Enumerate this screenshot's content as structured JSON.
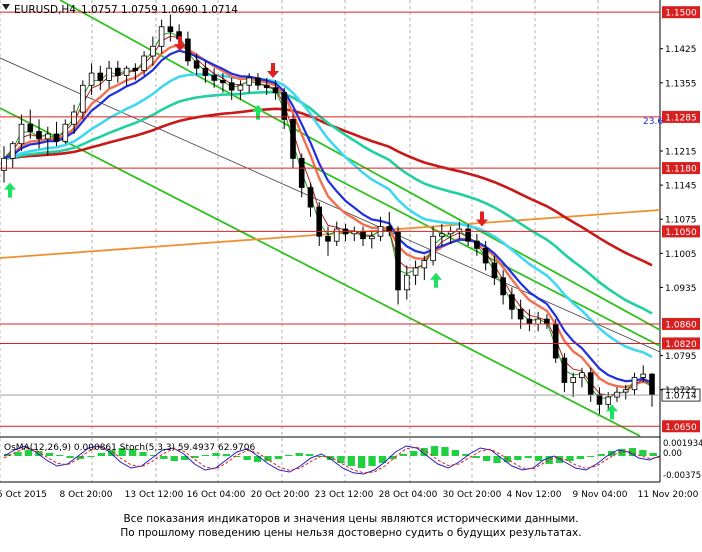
{
  "chart_data": {
    "type": "candlestick",
    "title": "EURUSD,H4  1.0757 1.0759 1.0690 1.0714",
    "symbol": "EURUSD,H4",
    "ohlc_header": "1.0757 1.0759 1.0690 1.0714",
    "ylim": [
      1.063,
      1.1525
    ],
    "price_ticks": [
      "1.1500",
      "1.1425",
      "1.1355",
      "1.1285",
      "1.1215",
      "1.1145",
      "1.1075",
      "1.1005",
      "1.0935",
      "1.0860",
      "1.0795",
      "1.0725",
      "1.0650"
    ],
    "x_labels": [
      "5 Oct 2015",
      "8 Oct 20:00",
      "13 Oct 12:00",
      "16 Oct 04:00",
      "20 Oct 20:00",
      "23 Oct 12:00",
      "28 Oct 04:00",
      "30 Oct 20:00",
      "4 Nov 12:00",
      "9 Nov 04:00",
      "11 Nov 20:00"
    ],
    "levels": [
      {
        "label": "1.1500",
        "value": 1.15
      },
      {
        "label": "1.1285",
        "value": 1.1285
      },
      {
        "label": "1.1180",
        "value": 1.118
      },
      {
        "label": "1.1050",
        "value": 1.105
      },
      {
        "label": "1.0860",
        "value": 1.086
      },
      {
        "label": "1.0820",
        "value": 1.082
      },
      {
        "label": "1.0650",
        "value": 1.065
      }
    ],
    "current_price": {
      "label": "1.0714",
      "value": 1.0714
    },
    "fib_label": "23.6",
    "colors": {
      "levels": "#d92020",
      "ema_fast": "#e03030",
      "ema_slow": "#c81818",
      "ema_mid": "#20d0a0",
      "ema_light": "#40d8f0",
      "trend": "#f09030",
      "channel": "#30c020",
      "signal_up": "#20e060",
      "signal_down": "#e02020",
      "blue": "#2030e0",
      "orange_ma": "#f07050"
    },
    "candles": [
      [
        1.1175,
        1.1225,
        1.115,
        1.12
      ],
      [
        1.12,
        1.1235,
        1.118,
        1.123
      ],
      [
        1.123,
        1.129,
        1.1215,
        1.127
      ],
      [
        1.127,
        1.13,
        1.124,
        1.1255
      ],
      [
        1.1255,
        1.128,
        1.122,
        1.124
      ],
      [
        1.124,
        1.1265,
        1.1205,
        1.125
      ],
      [
        1.125,
        1.1275,
        1.1225,
        1.1235
      ],
      [
        1.1235,
        1.128,
        1.123,
        1.127
      ],
      [
        1.127,
        1.131,
        1.125,
        1.1295
      ],
      [
        1.1295,
        1.136,
        1.128,
        1.135
      ],
      [
        1.135,
        1.1395,
        1.133,
        1.1375
      ],
      [
        1.1375,
        1.139,
        1.134,
        1.136
      ],
      [
        1.136,
        1.14,
        1.1345,
        1.1385
      ],
      [
        1.1385,
        1.14,
        1.1355,
        1.137
      ],
      [
        1.137,
        1.139,
        1.135,
        1.1385
      ],
      [
        1.1385,
        1.1395,
        1.136,
        1.138
      ],
      [
        1.138,
        1.142,
        1.137,
        1.141
      ],
      [
        1.141,
        1.145,
        1.139,
        1.143
      ],
      [
        1.143,
        1.1485,
        1.1415,
        1.147
      ],
      [
        1.147,
        1.1495,
        1.144,
        1.146
      ],
      [
        1.146,
        1.1475,
        1.143,
        1.1445
      ],
      [
        1.1445,
        1.146,
        1.139,
        1.14
      ],
      [
        1.14,
        1.1415,
        1.137,
        1.1385
      ],
      [
        1.1385,
        1.14,
        1.1355,
        1.137
      ],
      [
        1.137,
        1.1385,
        1.1345,
        1.136
      ],
      [
        1.136,
        1.1375,
        1.1335,
        1.1355
      ],
      [
        1.1355,
        1.1365,
        1.132,
        1.134
      ],
      [
        1.134,
        1.136,
        1.132,
        1.135
      ],
      [
        1.135,
        1.1375,
        1.1335,
        1.1365
      ],
      [
        1.1365,
        1.1375,
        1.134,
        1.135
      ],
      [
        1.135,
        1.1365,
        1.133,
        1.1345
      ],
      [
        1.1345,
        1.136,
        1.132,
        1.1335
      ],
      [
        1.1335,
        1.1345,
        1.126,
        1.128
      ],
      [
        1.128,
        1.129,
        1.118,
        1.12
      ],
      [
        1.12,
        1.121,
        1.112,
        1.114
      ],
      [
        1.114,
        1.115,
        1.108,
        1.11
      ],
      [
        1.11,
        1.111,
        1.102,
        1.104
      ],
      [
        1.104,
        1.106,
        1.1,
        1.103
      ],
      [
        1.103,
        1.107,
        1.102,
        1.1055
      ],
      [
        1.1055,
        1.1065,
        1.103,
        1.1045
      ],
      [
        1.1045,
        1.106,
        1.103,
        1.105
      ],
      [
        1.105,
        1.106,
        1.102,
        1.1035
      ],
      [
        1.1035,
        1.105,
        1.1015,
        1.104
      ],
      [
        1.104,
        1.108,
        1.103,
        1.106
      ],
      [
        1.106,
        1.109,
        1.104,
        1.105
      ],
      [
        1.105,
        1.106,
        1.09,
        1.093
      ],
      [
        1.093,
        1.098,
        1.091,
        1.096
      ],
      [
        1.096,
        1.099,
        1.094,
        1.0975
      ],
      [
        1.0975,
        1.1,
        1.095,
        1.099
      ],
      [
        1.099,
        1.106,
        1.098,
        1.104
      ],
      [
        1.104,
        1.1065,
        1.102,
        1.1045
      ],
      [
        1.1045,
        1.106,
        1.1025,
        1.105
      ],
      [
        1.105,
        1.107,
        1.1035,
        1.1055
      ],
      [
        1.1055,
        1.1065,
        1.102,
        1.103
      ],
      [
        1.103,
        1.1045,
        1.1,
        1.1015
      ],
      [
        1.1015,
        1.103,
        1.097,
        1.0985
      ],
      [
        1.0985,
        1.1,
        1.094,
        1.0955
      ],
      [
        1.0955,
        1.097,
        1.09,
        1.092
      ],
      [
        1.092,
        1.0935,
        1.087,
        1.089
      ],
      [
        1.089,
        1.091,
        1.085,
        1.087
      ],
      [
        1.087,
        1.089,
        1.0845,
        1.086
      ],
      [
        1.086,
        1.0885,
        1.0845,
        1.087
      ],
      [
        1.087,
        1.088,
        1.085,
        1.086
      ],
      [
        1.086,
        1.087,
        1.078,
        1.079
      ],
      [
        1.079,
        1.08,
        1.072,
        1.074
      ],
      [
        1.074,
        1.076,
        1.071,
        1.075
      ],
      [
        1.075,
        1.077,
        1.073,
        1.076
      ],
      [
        1.076,
        1.077,
        1.07,
        1.0715
      ],
      [
        1.0715,
        1.073,
        1.0675,
        1.0695
      ],
      [
        1.0695,
        1.072,
        1.0685,
        1.071
      ],
      [
        1.071,
        1.073,
        1.07,
        1.072
      ],
      [
        1.072,
        1.0735,
        1.0705,
        1.0725
      ],
      [
        1.0725,
        1.076,
        1.0715,
        1.075
      ],
      [
        1.075,
        1.0775,
        1.074,
        1.0757
      ],
      [
        1.0757,
        1.0759,
        1.069,
        1.0714
      ]
    ],
    "indicator_text": "OsMA(12,26,9) 0.000861  Stoch(5,3,3) 59.4937 62.9706",
    "indicator_ticks": [
      "0.001934",
      "0.00",
      "-0.00375"
    ],
    "osma_values": [
      0.2,
      0.4,
      0.6,
      0.5,
      0.3,
      0.1,
      -0.2,
      -0.3,
      -0.1,
      0.3,
      0.6,
      0.8,
      0.7,
      0.4,
      0.1,
      -0.3,
      -0.5,
      -0.4,
      -0.2,
      0.1,
      0.3,
      0.2,
      -0.1,
      -0.4,
      -0.6,
      -0.5,
      -0.3,
      0.1,
      0.3,
      0.2,
      -0.1,
      -0.4,
      -0.7,
      -1.0,
      -1.2,
      -1.0,
      -0.7,
      -0.3,
      0.2,
      0.5,
      0.8,
      1.0,
      0.9,
      0.6,
      0.2,
      -0.2,
      -0.5,
      -0.7,
      -0.6,
      -0.4,
      -0.2,
      -0.5,
      -0.8,
      -0.7,
      -0.5,
      -0.3,
      -0.1,
      0.2,
      0.5,
      0.7,
      0.8,
      0.6,
      0.3
    ],
    "stoch_main": [
      60,
      75,
      85,
      70,
      50,
      35,
      40,
      60,
      80,
      85,
      70,
      45,
      30,
      35,
      55,
      75,
      80,
      65,
      40,
      25,
      30,
      50,
      70,
      78,
      60,
      40,
      25,
      20,
      35,
      55,
      65,
      50,
      30,
      18,
      15,
      25,
      45,
      70,
      85,
      80,
      60,
      40,
      30,
      45,
      65,
      80,
      75,
      55,
      35,
      25,
      30,
      50,
      60,
      45,
      30,
      25,
      40,
      60,
      75,
      70,
      55,
      50,
      60
    ],
    "stoch_signal": [
      55,
      68,
      80,
      75,
      58,
      42,
      38,
      52,
      72,
      82,
      76,
      55,
      38,
      33,
      46,
      65,
      78,
      72,
      52,
      33,
      28,
      42,
      62,
      74,
      68,
      50,
      33,
      24,
      30,
      46,
      60,
      56,
      40,
      25,
      18,
      20,
      35,
      58,
      78,
      82,
      70,
      50,
      36,
      40,
      56,
      72,
      77,
      63,
      45,
      30,
      28,
      42,
      56,
      52,
      38,
      29,
      35,
      52,
      68,
      72,
      62,
      54,
      57
    ]
  },
  "disclaimer": {
    "line1": "Все показания индикаторов и значения цены являются историческими данными.",
    "line2": "По прошлому поведению цены нельзя достоверно судить о будущих результатах."
  }
}
